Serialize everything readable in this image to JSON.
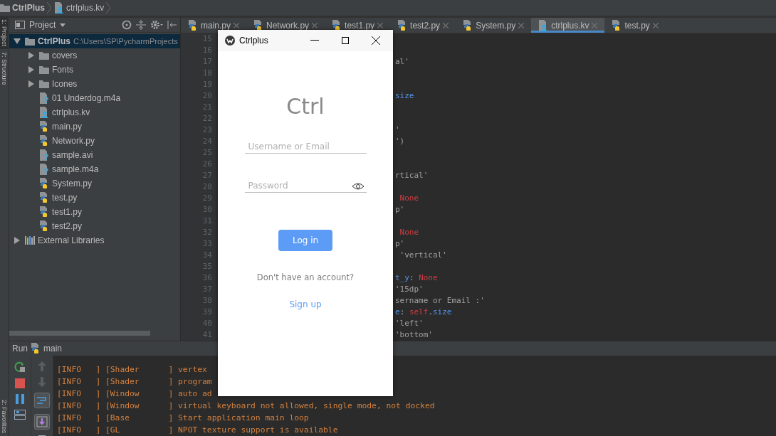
{
  "breadcrumb": [
    {
      "label": "CtrlPlus",
      "kind": "folder"
    },
    {
      "label": "ctrlplus.kv",
      "kind": "kv"
    }
  ],
  "side_strip": [
    {
      "label": "1: Project",
      "selected": true
    },
    {
      "label": "7: Structure",
      "selected": false
    },
    {
      "label": "2: Favorites",
      "selected": false
    }
  ],
  "project_panel": {
    "title": "Project",
    "tree": [
      {
        "label": "CtrlPlus",
        "path": "C:\\Users\\SP\\PycharmProjects",
        "kind": "folder",
        "expanded": true,
        "selected": true,
        "children": [
          {
            "label": "covers",
            "kind": "folder",
            "expanded": false,
            "selected": false
          },
          {
            "label": "Fonts",
            "kind": "folder",
            "expanded": false,
            "selected": false
          },
          {
            "label": "Icones",
            "kind": "folder",
            "expanded": false,
            "selected": false
          },
          {
            "label": "01 Underdog.m4a",
            "kind": "unknown",
            "selected": false
          },
          {
            "label": "ctrlplus.kv",
            "kind": "kv",
            "selected": false
          },
          {
            "label": "main.py",
            "kind": "python",
            "selected": false
          },
          {
            "label": "Network.py",
            "kind": "python",
            "selected": false
          },
          {
            "label": "sample.avi",
            "kind": "unknown",
            "selected": false
          },
          {
            "label": "sample.m4a",
            "kind": "unknown",
            "selected": false
          },
          {
            "label": "System.py",
            "kind": "python",
            "selected": false
          },
          {
            "label": "test.py",
            "kind": "python",
            "selected": false
          },
          {
            "label": "test1.py",
            "kind": "python",
            "selected": false
          },
          {
            "label": "test2.py",
            "kind": "python",
            "selected": false
          }
        ]
      },
      {
        "label": "External Libraries",
        "kind": "library",
        "expanded": false,
        "selected": false
      }
    ]
  },
  "editor": {
    "tabs": [
      {
        "label": "main.py",
        "kind": "python",
        "selected": false
      },
      {
        "label": "Network.py",
        "kind": "python",
        "selected": false
      },
      {
        "label": "test1.py",
        "kind": "python",
        "selected": false
      },
      {
        "label": "test2.py",
        "kind": "python",
        "selected": false
      },
      {
        "label": "System.py",
        "kind": "python",
        "selected": false
      },
      {
        "label": "ctrlplus.kv",
        "kind": "kv",
        "selected": true
      },
      {
        "label": "test.py",
        "kind": "python",
        "selected": false
      }
    ],
    "lines": [
      {
        "number": "15"
      },
      {
        "number": "16"
      },
      {
        "number": "17",
        "tokens": [
          {
            "kind": "string",
            "text": "al'"
          }
        ]
      },
      {
        "number": "18"
      },
      {
        "number": "19"
      },
      {
        "number": "20",
        "tokens": [
          {
            "kind": "attr",
            "text": "size"
          }
        ]
      },
      {
        "number": "21"
      },
      {
        "number": "22"
      },
      {
        "number": "23",
        "tokens": [
          {
            "kind": "string",
            "text": "'"
          }
        ]
      },
      {
        "number": "24",
        "tokens": [
          {
            "kind": "string",
            "text": "')"
          }
        ]
      },
      {
        "number": "25"
      },
      {
        "number": "26"
      },
      {
        "number": "27",
        "tokens": [
          {
            "kind": "string",
            "text": "rtical'"
          }
        ]
      },
      {
        "number": "28"
      },
      {
        "number": "29",
        "tokens": [
          {
            "kind": "keyword",
            "text": " None"
          }
        ]
      },
      {
        "number": "30",
        "tokens": [
          {
            "kind": "string",
            "text": "p'"
          }
        ]
      },
      {
        "number": "31"
      },
      {
        "number": "32",
        "tokens": [
          {
            "kind": "keyword",
            "text": " None"
          }
        ]
      },
      {
        "number": "33",
        "tokens": [
          {
            "kind": "string",
            "text": "p'"
          }
        ]
      },
      {
        "number": "34",
        "tokens": [
          {
            "kind": "string",
            "text": " 'vertical'"
          }
        ]
      },
      {
        "number": "35"
      },
      {
        "number": "36",
        "tokens": [
          {
            "kind": "attr",
            "text": "t_y"
          },
          {
            "kind": "plain",
            "text": ": "
          },
          {
            "kind": "keyword",
            "text": "None"
          }
        ]
      },
      {
        "number": "37",
        "tokens": [
          {
            "kind": "string",
            "text": "'15dp'"
          }
        ]
      },
      {
        "number": "38",
        "tokens": [
          {
            "kind": "string",
            "text": "sername or Email :'"
          }
        ]
      },
      {
        "number": "39",
        "tokens": [
          {
            "kind": "attr",
            "text": "e"
          },
          {
            "kind": "plain",
            "text": ": "
          },
          {
            "kind": "keyword",
            "text": "self"
          },
          {
            "kind": "plain",
            "text": "."
          },
          {
            "kind": "attr",
            "text": "size"
          }
        ]
      },
      {
        "number": "40",
        "tokens": [
          {
            "kind": "string",
            "text": "'left'"
          }
        ]
      },
      {
        "number": "41",
        "tokens": [
          {
            "kind": "string",
            "text": "'bottom'"
          }
        ]
      }
    ]
  },
  "app_window": {
    "title": "Ctrlplus",
    "heading": "Ctrl",
    "username": {
      "placeholder": "Username or Email"
    },
    "password": {
      "placeholder": "Password"
    },
    "login_button": "Log in",
    "prompt": "Don't have an account?",
    "signup_link": "Sign up"
  },
  "run_panel": {
    "title": "Run",
    "config": "main",
    "log": [
      "[INFO   ] [Shader      ] vertex",
      "[INFO   ] [Shader      ] program",
      "[INFO   ] [Window      ] auto ad",
      "[INFO   ] [Window      ] virtual keyboard not allowed, single mode, not docked",
      "[INFO   ] [Base        ] Start application main loop",
      "[INFO   ] [GL          ] NPOT texture support is available"
    ]
  }
}
